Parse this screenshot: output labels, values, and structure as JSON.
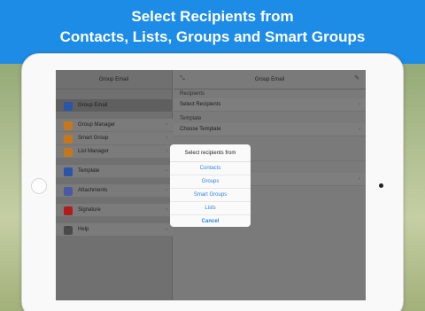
{
  "banner": {
    "line1": "Select Recipients from",
    "line2": "Contacts, Lists, Groups and Smart Groups"
  },
  "master": {
    "title": "Group Email",
    "items": [
      {
        "label": "Group Email",
        "icon": "envelope-icon",
        "color": "#2a55a8",
        "selected": true
      },
      {
        "label": "Group Manager",
        "icon": "bar-chart-icon",
        "color": "#c5771e"
      },
      {
        "label": "Smart Group",
        "icon": "magic-wand-icon",
        "color": "#c5771e"
      },
      {
        "label": "List Manager",
        "icon": "list-icon",
        "color": "#c5771e"
      },
      {
        "label": "Template",
        "icon": "document-icon",
        "color": "#2a55a8"
      },
      {
        "label": "Attachments",
        "icon": "paperclip-icon",
        "color": "#4b5aa0"
      },
      {
        "label": "Signature",
        "icon": "pen-icon",
        "color": "#b31a1a"
      },
      {
        "label": "Help",
        "icon": "question-icon",
        "color": "#4a4a4a"
      }
    ]
  },
  "detail": {
    "title": "Group Email",
    "sections": [
      {
        "header": "Recipients",
        "row": "Select Recipients"
      },
      {
        "header": "Template",
        "row": "Choose Template"
      }
    ]
  },
  "action_sheet": {
    "title": "Select recipients from",
    "options": [
      "Contacts",
      "Groups",
      "Smart Groups",
      "Lists"
    ],
    "cancel": "Cancel"
  }
}
